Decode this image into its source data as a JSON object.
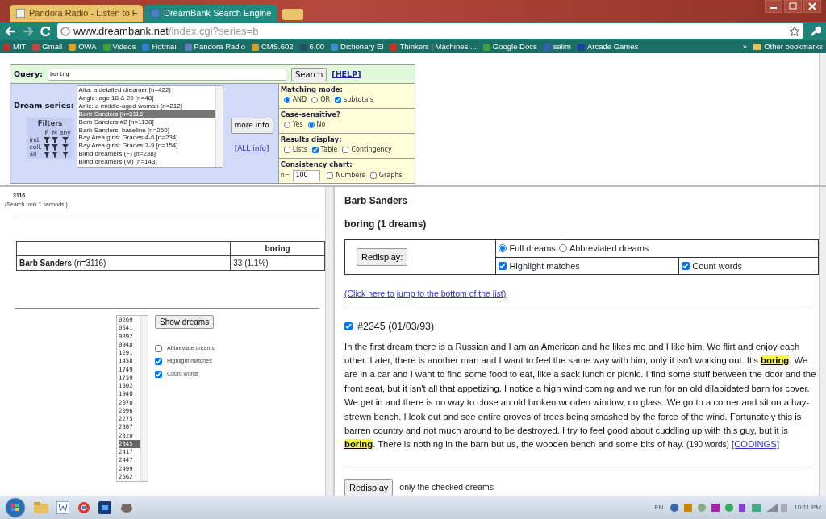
{
  "browser": {
    "tabs": [
      {
        "title": "Pandora Radio - Listen to F",
        "selected": false
      },
      {
        "title": "DreamBank Search Engine",
        "selected": true
      }
    ],
    "address": {
      "domain": "www.dreambank.net",
      "path": "/index.cgi?series=b"
    },
    "bookmarks": [
      {
        "label": "MIT",
        "color": "#c03030"
      },
      {
        "label": "Gmail",
        "color": "#d04040"
      },
      {
        "label": "OWA",
        "color": "#e0a020"
      },
      {
        "label": "Videos",
        "color": "#40a040"
      },
      {
        "label": "Hotmail",
        "color": "#3080d0"
      },
      {
        "label": "Pandora Radio",
        "color": "#6080c0"
      },
      {
        "label": "CMS.602",
        "color": "#d0a030"
      },
      {
        "label": "6.00",
        "color": "#205060"
      },
      {
        "label": "Dictionary El",
        "color": "#4090d0"
      },
      {
        "label": "Thinkers | Machines ...",
        "color": "#d03020"
      },
      {
        "label": "Google Docs",
        "color": "#40a040"
      },
      {
        "label": "salim",
        "color": "#3060b0"
      },
      {
        "label": "Arcade Games",
        "color": "#2040a0"
      }
    ],
    "bookmarks_overflow": "»",
    "other_bookmarks": "Other bookmarks"
  },
  "query": {
    "label": "Query:",
    "value": "boring",
    "search_button": "Search",
    "help_link": "[HELP]"
  },
  "series": {
    "label": "Dream series:",
    "items": [
      {
        "label": "Alta: a detailed dreamer [n=422]",
        "selected": false
      },
      {
        "label": "Angie: age 18 & 20 [n=48]",
        "selected": false
      },
      {
        "label": "Arlie: a middle-aged woman [n=212]",
        "selected": false
      },
      {
        "label": "Barb Sanders [n=3116]",
        "selected": true
      },
      {
        "label": "Barb Sanders #2 [n=1138]",
        "selected": false
      },
      {
        "label": "Barb Sanders: baseline [n=250]",
        "selected": false
      },
      {
        "label": "Bay Area girls: Grades 4-6 [n=234]",
        "selected": false
      },
      {
        "label": "Bay Area girls: Grades 7-9 [n=154]",
        "selected": false
      },
      {
        "label": "Blind dreamers (F) [n=238]",
        "selected": false
      },
      {
        "label": "Blind dreamers (M) [n=143]",
        "selected": false
      }
    ],
    "more_info_button": "more info",
    "all_info_link": "[ALL info]"
  },
  "filters": {
    "title": "Filters",
    "columns": [
      "F",
      "M",
      "any"
    ],
    "rows": [
      "ind.",
      "coll.",
      "all"
    ]
  },
  "options": {
    "matching": {
      "title": "Matching mode:",
      "choices": [
        {
          "label": "AND",
          "selected": true
        },
        {
          "label": "OR",
          "selected": false
        }
      ],
      "subtotals": {
        "label": "subtotals",
        "checked": true
      }
    },
    "case": {
      "title": "Case-sensitive?",
      "choices": [
        {
          "label": "Yes",
          "selected": false
        },
        {
          "label": "No",
          "selected": true
        }
      ]
    },
    "display": {
      "title": "Results display:",
      "checks": [
        {
          "label": "Lists",
          "checked": false
        },
        {
          "label": "Table",
          "checked": true
        },
        {
          "label": "Contingency",
          "checked": false
        }
      ]
    },
    "consistency": {
      "title": "Consistency chart:",
      "n_label": "n=",
      "n_value": "100",
      "checks": [
        {
          "label": "Numbers",
          "checked": false
        },
        {
          "label": "Graphs",
          "checked": false
        }
      ]
    }
  },
  "results": {
    "count": "3116",
    "timing": "(Search took 1 seconds.)",
    "table": {
      "column": "boring",
      "row_label": "Barb Sanders",
      "row_n": "(n=3116)",
      "cell": "33 (1.1%)"
    },
    "dream_ids": [
      {
        "id": "0269",
        "selected": false
      },
      {
        "id": "0641",
        "selected": false
      },
      {
        "id": "0892",
        "selected": false
      },
      {
        "id": "0948",
        "selected": false
      },
      {
        "id": "1291",
        "selected": false
      },
      {
        "id": "1458",
        "selected": false
      },
      {
        "id": "1749",
        "selected": false
      },
      {
        "id": "1759",
        "selected": false
      },
      {
        "id": "1802",
        "selected": false
      },
      {
        "id": "1940",
        "selected": false
      },
      {
        "id": "2070",
        "selected": false
      },
      {
        "id": "2096",
        "selected": false
      },
      {
        "id": "2275",
        "selected": false
      },
      {
        "id": "2307",
        "selected": false
      },
      {
        "id": "2320",
        "selected": false
      },
      {
        "id": "2345",
        "selected": true
      },
      {
        "id": "2417",
        "selected": false
      },
      {
        "id": "2447",
        "selected": false
      },
      {
        "id": "2499",
        "selected": false
      },
      {
        "id": "2562",
        "selected": false
      }
    ],
    "show_button": "Show dreams",
    "options": [
      {
        "label": "Abbreviate dreams",
        "checked": false
      },
      {
        "label": "Highlight matches",
        "checked": true
      },
      {
        "label": "Count words",
        "checked": true
      }
    ]
  },
  "dreams": {
    "series": "Barb Sanders",
    "heading": "boring (1 dreams)",
    "redisplay_button": "Redisplay:",
    "modes": [
      {
        "label": "Full dreams",
        "selected": true
      },
      {
        "label": "Abbreviated dreams",
        "selected": false
      }
    ],
    "options": [
      {
        "label": "Highlight matches",
        "checked": true
      },
      {
        "label": "Count words",
        "checked": true
      }
    ],
    "jump_link": "(Click here to jump to the bottom of the list)",
    "items": [
      {
        "checked": true,
        "title": "#2345 (01/03/93)",
        "text": "In the first dream there is a Russian and I am an American and he likes me and I like him. We flirt and enjoy each other. Later, there is another man and I want to feel the same way with him, only it isn't working out. It's **boring**. We are in a car and I want to find some food to eat, like a sack lunch or picnic. I find some stuff between the door and the front seat, but it isn't all that appetizing. I notice a high wind coming and we run for an old dilapidated barn for cover. We get in and there is no way to close an old broken wooden window, no glass. We go to a corner and sit on a hay-strewn bench. I look out and see entire groves of trees being smashed by the force of the wind. Fortunately this is barren country and not much around to be destroyed. I try to feel good about cuddling up with this guy, but it is **boring**. There is nothing in the barn but us, the wooden bench and some bits of hay.",
        "word_count": "(190 words)",
        "codings_link": "[CODINGS]"
      }
    ],
    "footer_button": "Redisplay",
    "footer_note": "only the checked dreams"
  },
  "taskbar": {
    "language": "EN",
    "time": "10:11 PM"
  }
}
